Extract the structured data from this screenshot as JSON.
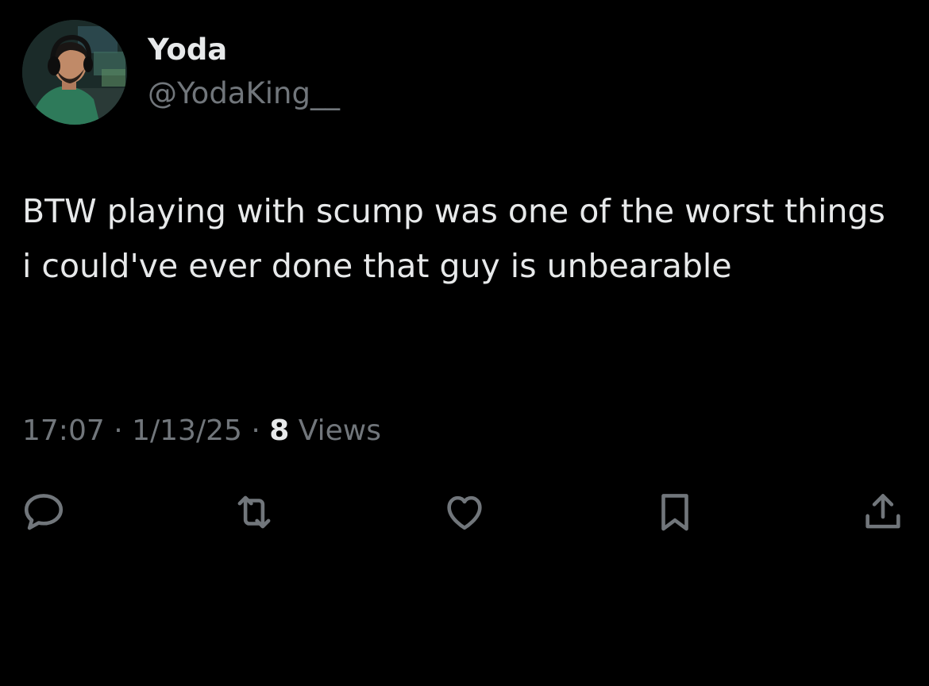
{
  "author": {
    "display_name": "Yoda",
    "handle": "@YodaKing__",
    "avatar_icon": "profile-photo"
  },
  "tweet": {
    "text": "BTW playing with scump was one of the worst things i could've ever done that guy is unbearable"
  },
  "meta": {
    "time": "17:07",
    "separator": "·",
    "date": "1/13/25",
    "views_count": "8",
    "views_label": "Views"
  },
  "actions": [
    {
      "name": "reply",
      "icon": "reply-icon"
    },
    {
      "name": "retweet",
      "icon": "retweet-icon"
    },
    {
      "name": "like",
      "icon": "heart-icon"
    },
    {
      "name": "bookmark",
      "icon": "bookmark-icon"
    },
    {
      "name": "share",
      "icon": "share-icon"
    }
  ],
  "colors": {
    "background": "#000000",
    "primary_text": "#e7e9ea",
    "secondary_text": "#71767b"
  }
}
